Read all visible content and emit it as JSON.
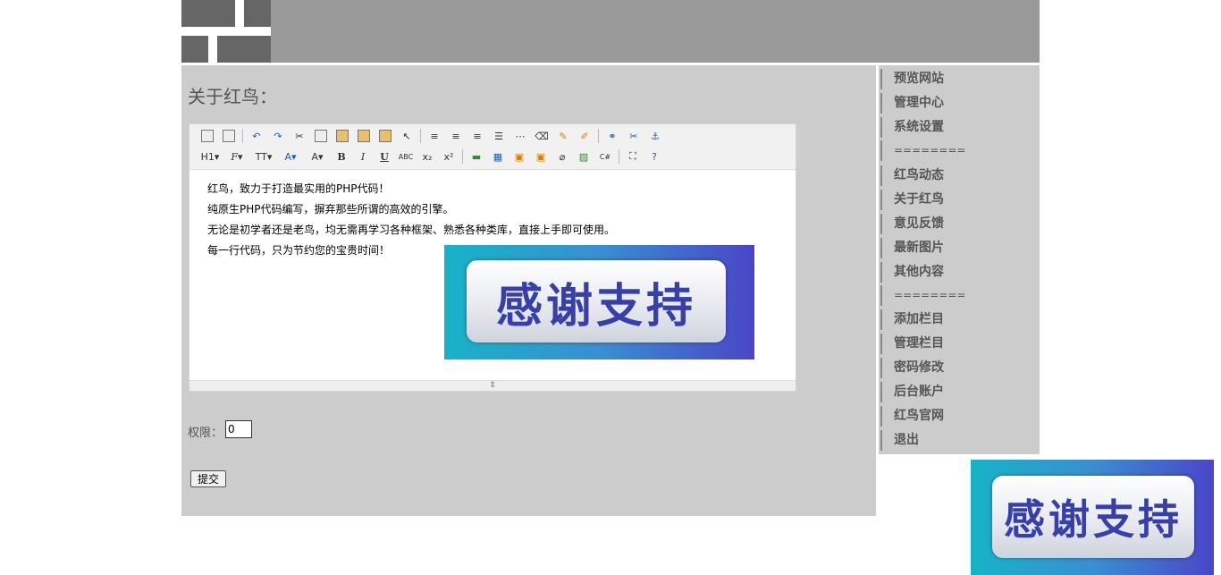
{
  "header": {},
  "main": {
    "title": "关于红鸟："
  },
  "editor": {
    "toolbar_row1": [
      "paste-word-icon",
      "preview-icon",
      "undo-icon",
      "redo-icon",
      "cut-icon",
      "copy-icon",
      "paste-icon",
      "paste-text-icon",
      "paste-word2-icon",
      "select-icon",
      "align-left-icon",
      "align-center-icon",
      "align-right-icon",
      "align-justify-icon",
      "hr-icon",
      "eraser-icon",
      "brush-icon",
      "source-icon",
      "link-icon",
      "unlink-icon",
      "anchor-icon"
    ],
    "toolbar_row2": {
      "heading": "H1",
      "font_family": "F",
      "font_size": "TT",
      "font_color": "A",
      "highlight": "A",
      "bold": "B",
      "italic": "I",
      "underline": "U",
      "strike": "ABC",
      "subscript": "x₂",
      "superscript": "x²"
    },
    "content": {
      "line1": "红鸟，致力于打造最实用的PHP代码！",
      "line2": "纯原生PHP代码编写，摒弃那些所谓的高效的引擎。",
      "line3": "无论是初学者还是老鸟，均无需再学习各种框架、熟悉各种类库，直接上手即可使用。",
      "line4": "每一行代码，只为节约您的宝贵时间！"
    },
    "image_text": "感谢支持"
  },
  "form": {
    "permission_label": "权限：",
    "permission_value": "0",
    "submit_label": "提交"
  },
  "sidebar": {
    "items": [
      {
        "label": "预览网站"
      },
      {
        "label": "管理中心"
      },
      {
        "label": "系统设置"
      },
      {
        "label": "========"
      },
      {
        "label": "红鸟动态"
      },
      {
        "label": "关于红鸟"
      },
      {
        "label": "意见反馈"
      },
      {
        "label": "最新图片"
      },
      {
        "label": "其他内容"
      },
      {
        "label": "========"
      },
      {
        "label": "添加栏目"
      },
      {
        "label": "管理栏目"
      },
      {
        "label": "密码修改"
      },
      {
        "label": "后台账户"
      },
      {
        "label": "红鸟官网"
      },
      {
        "label": "退出"
      }
    ]
  },
  "footer_image_text": "感谢支持",
  "colors": {
    "header_bg": "#999999",
    "logo_block": "#666666",
    "panel_bg": "#cccccc",
    "banner_text": "#3740a8"
  }
}
